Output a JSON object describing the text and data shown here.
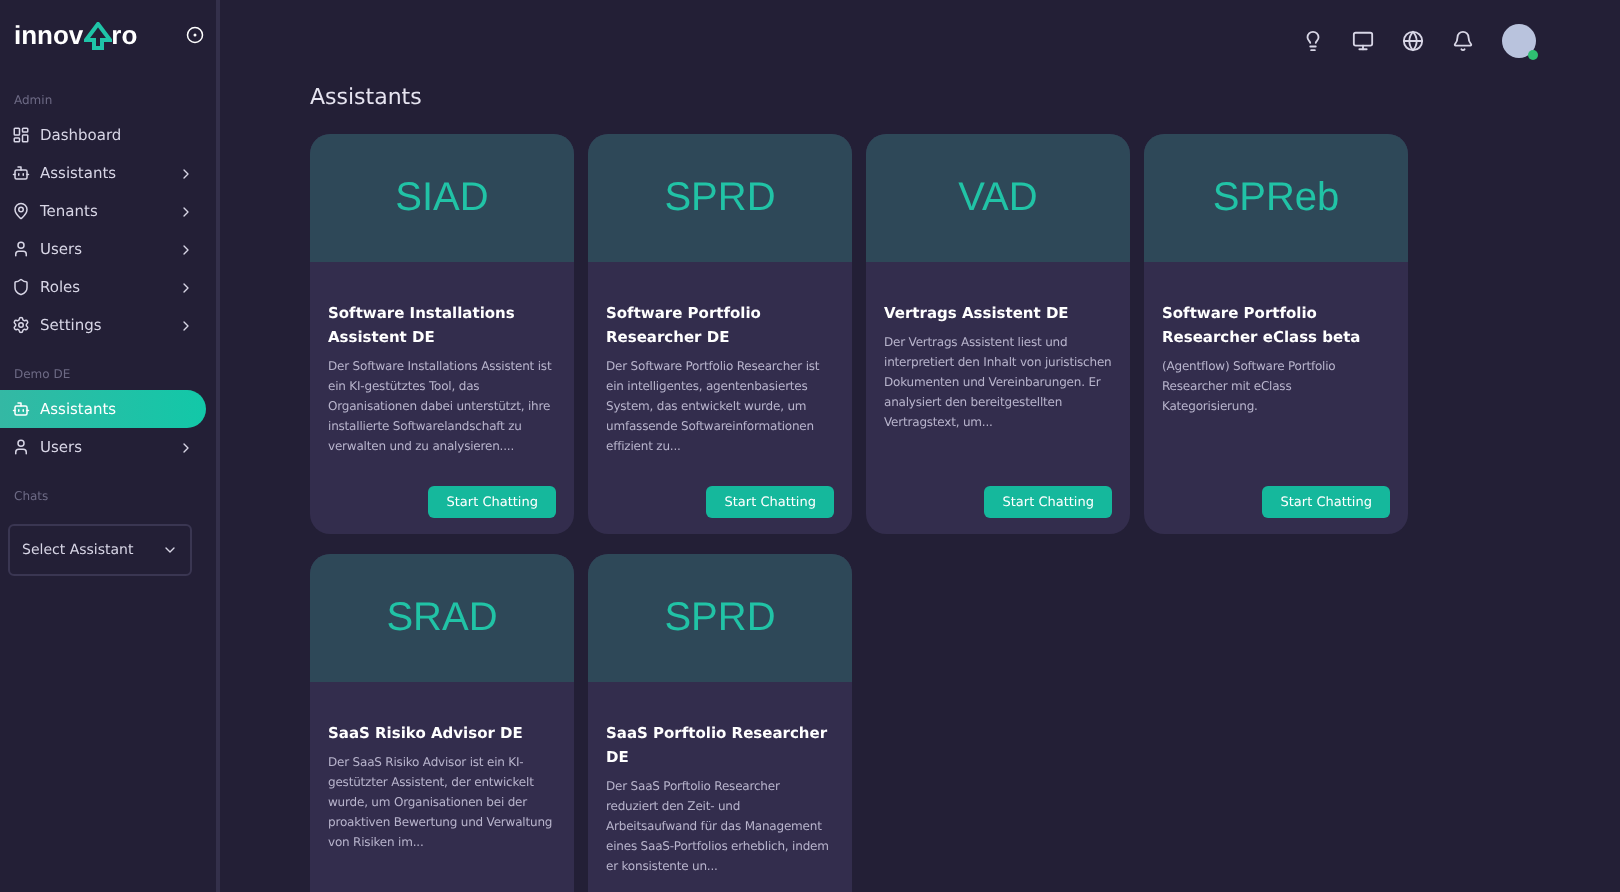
{
  "logo": {
    "prefix": "innov",
    "suffix": "ro"
  },
  "sidebar": {
    "sections": [
      {
        "title": "Admin",
        "items": [
          {
            "label": "Dashboard",
            "expandable": false,
            "selected": false
          },
          {
            "label": "Assistants",
            "expandable": true,
            "selected": false
          },
          {
            "label": "Tenants",
            "expandable": true,
            "selected": false
          },
          {
            "label": "Users",
            "expandable": true,
            "selected": false
          },
          {
            "label": "Roles",
            "expandable": true,
            "selected": false
          },
          {
            "label": "Settings",
            "expandable": true,
            "selected": false
          }
        ]
      },
      {
        "title": "Demo DE",
        "items": [
          {
            "label": "Assistants",
            "expandable": false,
            "selected": true
          },
          {
            "label": "Users",
            "expandable": true,
            "selected": false
          }
        ]
      },
      {
        "title": "Chats",
        "select": {
          "placeholder": "Select Assistant"
        }
      }
    ]
  },
  "page_title": "Assistants",
  "cards": [
    {
      "code": "SIAD",
      "title": "Software Installations Assistent DE",
      "description": "Der Software Installations Assistent ist ein KI-gestütztes Tool, das Organisationen dabei unterstützt, ihre installierte Softwarelandschaft zu verwalten und zu analysieren....",
      "button": "Start Chatting"
    },
    {
      "code": "SPRD",
      "title": "Software Portfolio Researcher DE",
      "description": "Der Software Portfolio Researcher ist ein intelligentes, agentenbasiertes System, das entwickelt wurde, um umfassende Softwareinformationen effizient zu...",
      "button": "Start Chatting"
    },
    {
      "code": "VAD",
      "title": "Vertrags Assistent DE",
      "description": "Der Vertrags Assistent liest und interpretiert den Inhalt von juristischen Dokumenten und Vereinbarungen. Er analysiert den bereitgestellten Vertragstext, um...",
      "button": "Start Chatting"
    },
    {
      "code": "SPReb",
      "title": "Software Portfolio Researcher eClass beta",
      "description": "(Agentflow) Software Portfolio Researcher mit eClass Kategorisierung.",
      "button": "Start Chatting"
    },
    {
      "code": "SRAD",
      "title": "SaaS Risiko Advisor DE",
      "description": "Der SaaS Risiko Advisor ist ein KI-gestützter Assistent, der entwickelt wurde, um Organisationen bei der proaktiven Bewertung und Verwaltung von Risiken im..."
    },
    {
      "code": "SPRD",
      "title": "SaaS Porftolio Researcher DE",
      "description": "Der SaaS Porftolio Researcher reduziert den Zeit- und Arbeitsaufwand für das Management eines SaaS-Portfolios erheblich, indem er konsistente un..."
    }
  ]
}
